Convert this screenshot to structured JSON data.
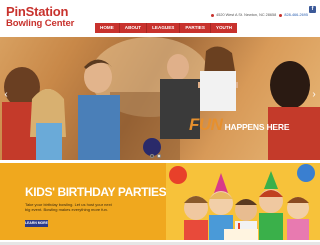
{
  "header": {
    "logo_line1": "PinStation",
    "logo_line2": "Bowling Center",
    "address": "4520 West A St. Newton, NC 28658",
    "phone": "828-466-2695",
    "facebook_label": "f"
  },
  "nav": {
    "items": [
      {
        "label": "HOME"
      },
      {
        "label": "ABOUT"
      },
      {
        "label": "LEAGUES"
      },
      {
        "label": "PARTIES"
      },
      {
        "label": "YOUTH"
      }
    ]
  },
  "hero": {
    "tagline_fun": "FUN",
    "tagline_rest": " HAPPENS HERE",
    "slides_total": 2,
    "active_slide": 1
  },
  "promo": {
    "title": "KIDS' BIRTHDAY PARTIES",
    "text": "Take your birthday bowling. Let us host your next big event. Bowling makes everything more fun.",
    "button_label": "LEARN MORE"
  },
  "colors": {
    "brand_red": "#c8322d",
    "promo_yellow": "#f0a81e",
    "button_navy": "#2b3a8a",
    "hero_orange": "#e7902d"
  }
}
